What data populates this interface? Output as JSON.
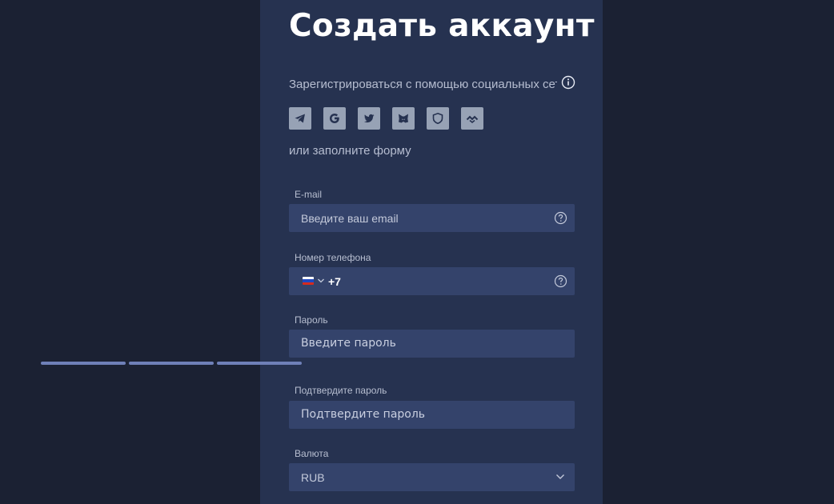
{
  "form": {
    "title": "Создать аккаунт",
    "social_text": "Зарегистрироваться с помощью социальных сет...",
    "or_text": "или заполните форму",
    "social_buttons": [
      "telegram-icon",
      "google-icon",
      "twitter-icon",
      "metamask-icon",
      "shield-icon",
      "waves-icon"
    ],
    "email": {
      "label": "E-mail",
      "placeholder": "Введите ваш email"
    },
    "phone": {
      "label": "Номер телефона",
      "country": "RU",
      "code": "+7"
    },
    "password": {
      "label": "Пароль",
      "placeholder": "Введите пароль"
    },
    "confirm_password": {
      "label": "Подтвердите пароль",
      "placeholder": "Подтвердите пароль"
    },
    "currency": {
      "label": "Валюта",
      "value": "RUB"
    }
  },
  "colors": {
    "page_bg": "#1b2133",
    "panel_bg": "#263250",
    "input_bg": "#34436b",
    "social_btn": "#97a2b5",
    "strength_bar": "#6f80b8"
  }
}
